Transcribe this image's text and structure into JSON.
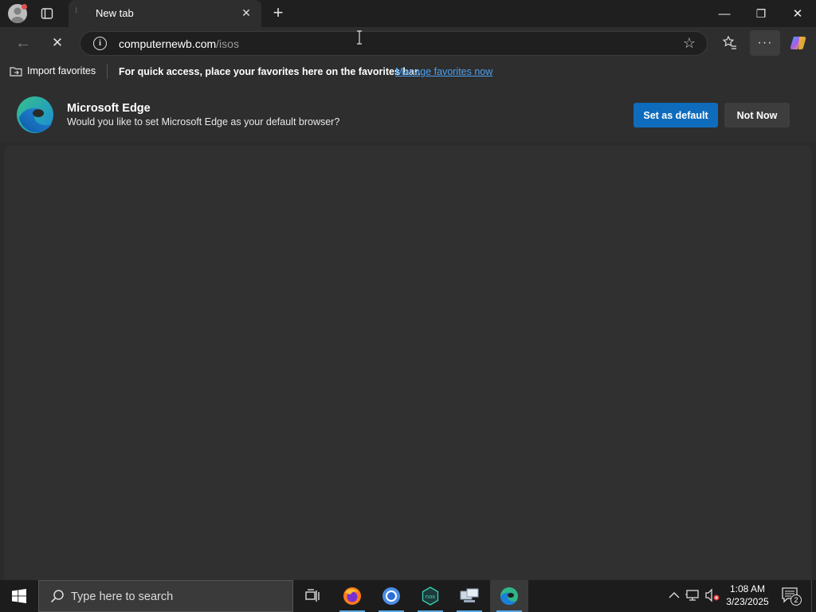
{
  "window": {
    "minimize": "—",
    "restore": "❐",
    "close": "✕"
  },
  "tab": {
    "title": "New tab",
    "close_glyph": "✕",
    "new_tab_glyph": "+"
  },
  "toolbar": {
    "back_glyph": "←",
    "stop_glyph": "✕",
    "url_host": "computernewb.com",
    "url_path": "/isos",
    "favorites_star_glyph": "☆",
    "more_glyph": "···"
  },
  "favorites_bar": {
    "import_label": "Import favorites",
    "message": "For quick access, place your favorites here on the favorites bar.",
    "manage_link": "Manage favorites now"
  },
  "banner": {
    "title": "Microsoft Edge",
    "subtitle": "Would you like to set Microsoft Edge as your default browser?",
    "set_default_label": "Set as default",
    "not_now_label": "Not Now"
  },
  "taskbar": {
    "search_placeholder": "Type here to search",
    "time": "1:08 AM",
    "date": "3/23/2025",
    "notification_count": "2"
  },
  "colors": {
    "accent": "#0f6cbd",
    "link": "#4ca0f0",
    "background": "#2b2b2b"
  }
}
